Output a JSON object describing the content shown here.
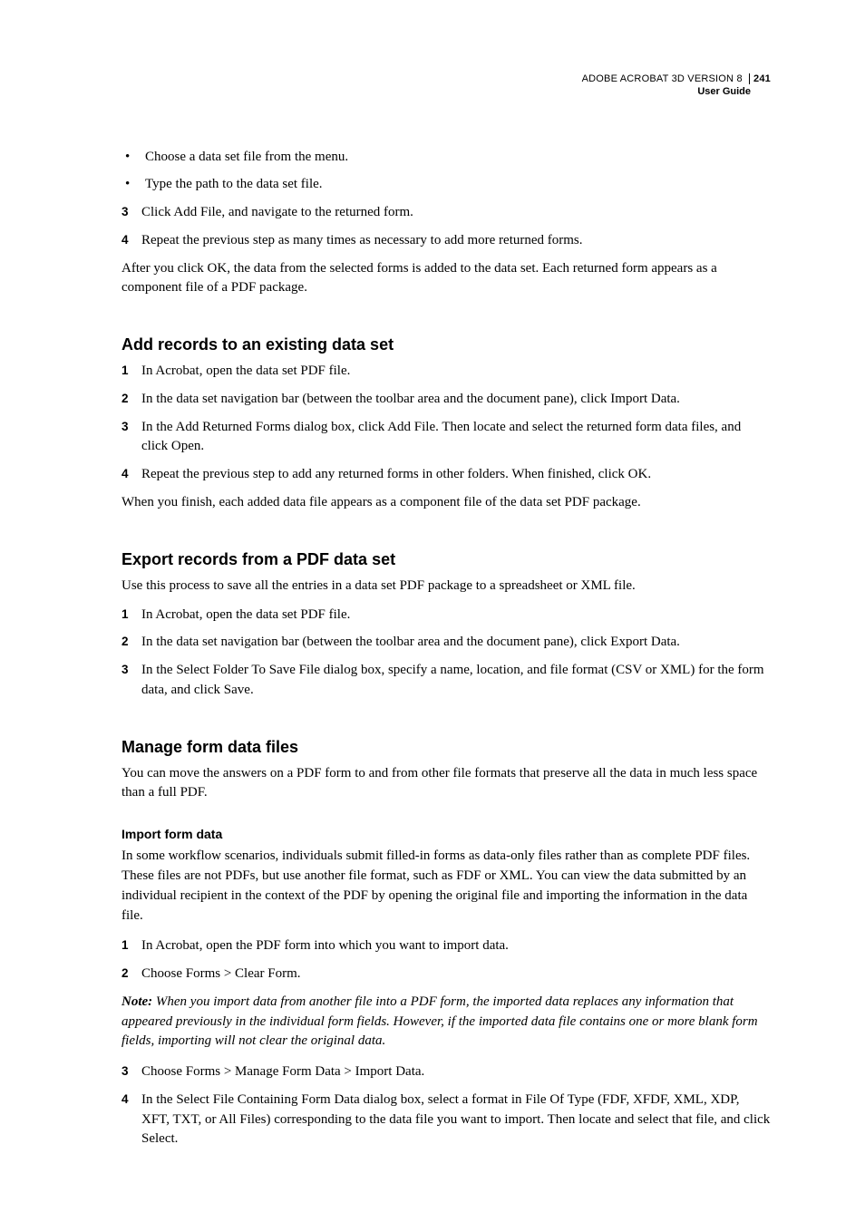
{
  "header": {
    "product": "ADOBE ACROBAT 3D VERSION 8",
    "page_number": "241",
    "doc_title": "User Guide"
  },
  "top_bullets": [
    "Choose a data set file from the menu.",
    "Type the path to the data set file."
  ],
  "top_steps": [
    {
      "n": "3",
      "t": "Click Add File, and navigate to the returned form."
    },
    {
      "n": "4",
      "t": "Repeat the previous step as many times as necessary to add more returned forms."
    }
  ],
  "top_paragraph": "After you click OK, the data from the selected forms is added to the data set. Each returned form appears as a component file of a PDF package.",
  "sec1": {
    "title": "Add records to an existing data set",
    "steps": [
      {
        "n": "1",
        "t": "In Acrobat, open the data set PDF file."
      },
      {
        "n": "2",
        "t": "In the data set navigation bar (between the toolbar area and the document pane), click Import Data."
      },
      {
        "n": "3",
        "t": "In the Add Returned Forms dialog box, click Add File. Then locate and select the returned form data files, and click Open."
      },
      {
        "n": "4",
        "t": "Repeat the previous step to add any returned forms in other folders. When finished, click OK."
      }
    ],
    "closing": "When you finish, each added data file appears as a component file of the data set PDF package."
  },
  "sec2": {
    "title": "Export records from a PDF data set",
    "intro": "Use this process to save all the entries in a data set PDF package to a spreadsheet or XML file.",
    "steps": [
      {
        "n": "1",
        "t": "In Acrobat, open the data set PDF file."
      },
      {
        "n": "2",
        "t": "In the data set navigation bar (between the toolbar area and the document pane), click Export Data."
      },
      {
        "n": "3",
        "t": "In the Select Folder To Save File dialog box, specify a name, location, and file format (CSV or XML) for the form data, and click Save."
      }
    ]
  },
  "sec3": {
    "title": "Manage form data files",
    "intro": "You can move the answers on a PDF form to and from other file formats that preserve all the data in much less space than a full PDF.",
    "sub_title": "Import form data",
    "sub_intro": "In some workflow scenarios, individuals submit filled-in forms as data-only files rather than as complete PDF files. These files are not PDFs, but use another file format, such as FDF or XML. You can view the data submitted by an individual recipient in the context of the PDF by opening the original file and importing the information in the data file.",
    "steps_a": [
      {
        "n": "1",
        "t": "In Acrobat, open the PDF form into which you want to import data."
      },
      {
        "n": "2",
        "t": "Choose Forms > Clear Form."
      }
    ],
    "note_label": "Note:",
    "note_body": " When you import data from another file into a PDF form, the imported data replaces any information that appeared previously in the individual form fields. However, if the imported data file contains one or more blank form fields, importing will not clear the original data.",
    "steps_b": [
      {
        "n": "3",
        "t": "Choose Forms > Manage Form Data > Import Data."
      },
      {
        "n": "4",
        "t": "In the Select File Containing Form Data dialog box, select a format in File Of Type (FDF, XFDF, XML, XDP, XFT, TXT, or All Files) corresponding to the data file you want to import. Then locate and select that file, and click Select."
      }
    ]
  }
}
